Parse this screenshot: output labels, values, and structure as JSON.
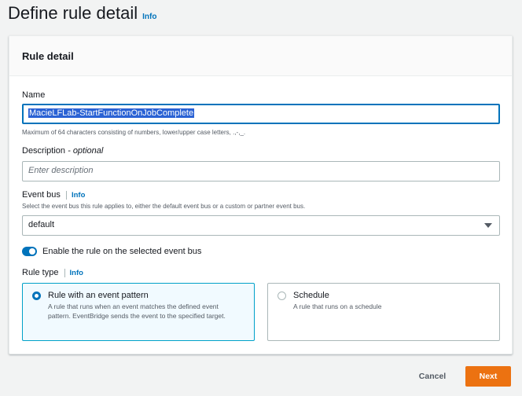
{
  "page": {
    "title": "Define rule detail",
    "info": "Info"
  },
  "panel": {
    "title": "Rule detail"
  },
  "name_field": {
    "label": "Name",
    "value": "MacieLFLab-StartFunctionOnJobComplete",
    "hint": "Maximum of 64 characters consisting of numbers, lower/upper case letters, .,-,_."
  },
  "description_field": {
    "label": "Description",
    "optional": "- optional",
    "placeholder": "Enter description"
  },
  "event_bus": {
    "label": "Event bus",
    "info": "Info",
    "hint": "Select the event bus this rule applies to, either the default event bus or a custom or partner event bus.",
    "selected": "default"
  },
  "enable_toggle": {
    "label": "Enable the rule on the selected event bus",
    "checked": true
  },
  "rule_type": {
    "label": "Rule type",
    "info": "Info",
    "options": [
      {
        "title": "Rule with an event pattern",
        "description": "A rule that runs when an event matches the defined event pattern. EventBridge sends the event to the specified target.",
        "selected": true
      },
      {
        "title": "Schedule",
        "description": "A rule that runs on a schedule",
        "selected": false
      }
    ]
  },
  "actions": {
    "cancel": "Cancel",
    "next": "Next"
  },
  "colors": {
    "accent": "#0073bb",
    "primary_button": "#ec7211",
    "selected_tile_border": "#00a1c9"
  }
}
